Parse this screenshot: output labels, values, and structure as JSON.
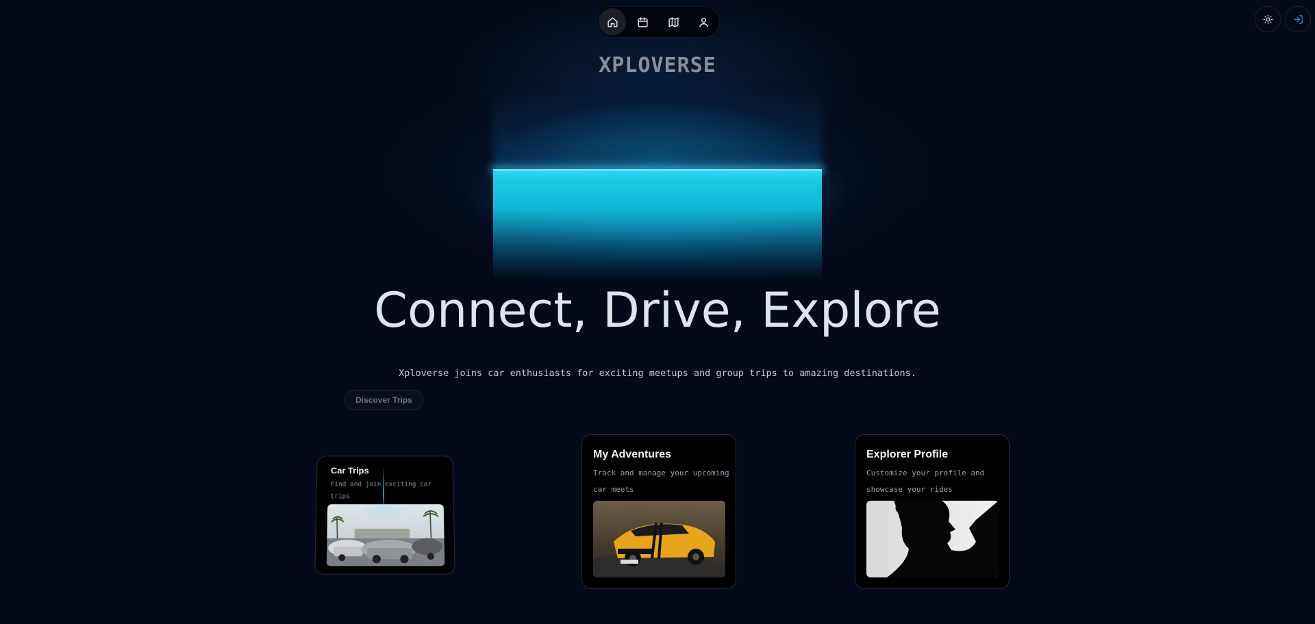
{
  "nav": {
    "items": [
      {
        "icon": "home-icon",
        "active": true
      },
      {
        "icon": "calendar-icon",
        "active": false
      },
      {
        "icon": "map-icon",
        "active": false
      },
      {
        "icon": "user-icon",
        "active": false
      }
    ]
  },
  "header_actions": {
    "theme_icon": "sun-icon",
    "login_icon": "login-icon",
    "login_color": "#3b82f6"
  },
  "brand": "XPLOVERSE",
  "hero": {
    "title": "Connect, Drive, Explore",
    "subtitle": "Xploverse joins car enthusiasts for exciting meetups and group trips to amazing destinations.",
    "cta": "Discover Trips"
  },
  "cards": [
    {
      "title": "Car Trips",
      "description": "Find and join exciting car trips",
      "image": "cars-on-street-photo"
    },
    {
      "title": "My Adventures",
      "description": "Track and manage your upcoming car meets",
      "image": "yellow-sports-car-photo"
    },
    {
      "title": "Explorer Profile",
      "description": "Customize your profile and showcase your rides",
      "image": "silhouette-profile-photo"
    }
  ],
  "colors": {
    "background": "#040a1a",
    "glow": "#1bd2ea",
    "card_bg": "#000000"
  }
}
